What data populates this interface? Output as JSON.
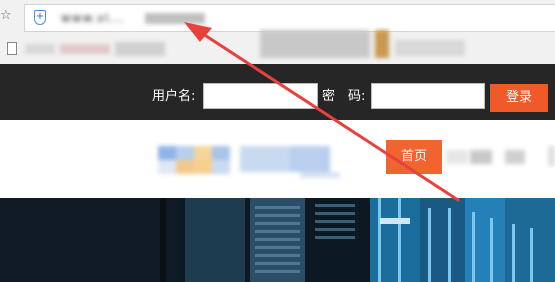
{
  "browser": {
    "url": "www.vi...",
    "star_icon": "☆",
    "shield_icon": "+"
  },
  "login_bar": {
    "username_label": "用户名:",
    "password_label": "密　码:",
    "username_value": "",
    "password_value": "",
    "login_button": "登录"
  },
  "nav": {
    "home_button": "首页"
  },
  "colors": {
    "accent": "#f05a28",
    "dark_bar": "#262626",
    "annotation": "#e8413c"
  },
  "annotation": {
    "arrow_icon": "red-arrow"
  }
}
